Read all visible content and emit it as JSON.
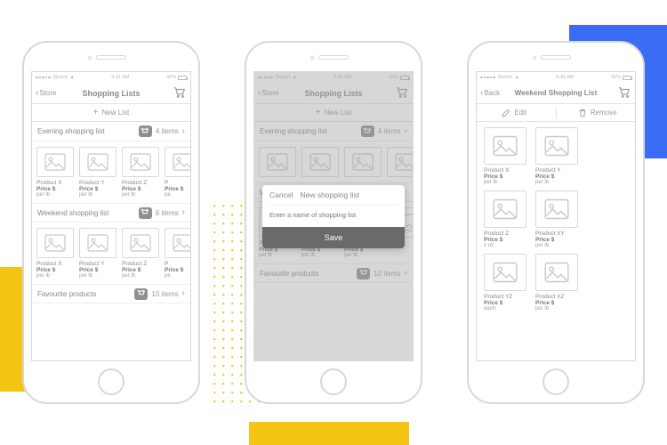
{
  "status": {
    "carrier": "Sketch",
    "time": "9:41 AM",
    "battery": "42%"
  },
  "phone1": {
    "back": "Store",
    "title": "Shopping Lists",
    "new_list": "New List",
    "lists": [
      {
        "name": "Evening shopping list",
        "count": "4 items"
      },
      {
        "name": "Weekend shopping list",
        "count": "6 items"
      },
      {
        "name": "Favourite products",
        "count": "10 items"
      }
    ],
    "product_stub": {
      "name": "Product",
      "price": "Price $",
      "unit": "per lb"
    },
    "px": "Product X",
    "py": "Product Y",
    "pz": "Product Z",
    "pp": "P"
  },
  "phone2": {
    "back": "Store",
    "title": "Shopping Lists",
    "new_list": "New List",
    "modal": {
      "cancel": "Cancel",
      "title": "New shopping list",
      "placeholder": "Enter a name of shopping list",
      "save": "Save"
    }
  },
  "phone3": {
    "back": "Back",
    "title": "Weekend Shopping List",
    "edit": "Edit",
    "remove": "Remove",
    "products": [
      {
        "name": "Product X",
        "price": "Price $",
        "unit": "per lb"
      },
      {
        "name": "Product Y",
        "price": "Price $",
        "unit": "per lb"
      },
      {
        "name": "Product Z",
        "price": "Price $",
        "unit": "x oz"
      },
      {
        "name": "Product XY",
        "price": "Price $",
        "unit": "per lb"
      },
      {
        "name": "Product YZ",
        "price": "Price $",
        "unit": "each"
      },
      {
        "name": "Product XZ",
        "price": "Price $",
        "unit": "per lb"
      }
    ]
  }
}
